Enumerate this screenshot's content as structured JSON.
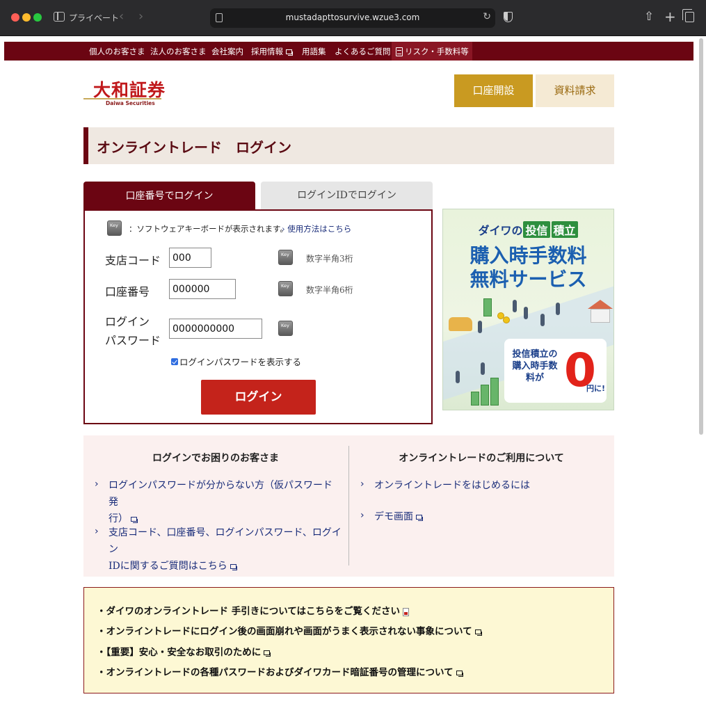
{
  "browser": {
    "private_label": "プライベート",
    "url": "mustadapttosurvive.wzue3.com",
    "back_glyph": "‹",
    "forward_glyph": "›",
    "reload_glyph": "↻",
    "share_glyph": "⇧",
    "newtab_glyph": "+"
  },
  "nav": {
    "items": [
      "個人のお客さま",
      "法人のお客さま",
      "会社案内",
      "採用情報",
      "用語集",
      "よくあるご質問",
      "リスク・手数料等"
    ]
  },
  "logo": {
    "name": "大和証券",
    "sub": "Daiwa Securities"
  },
  "header": {
    "open_account": "口座開設",
    "request_docs": "資料請求"
  },
  "page_title": "オンライントレード　ログイン",
  "tabs": {
    "active": "口座番号でログイン",
    "inactive": "ログインIDでログイン"
  },
  "form": {
    "note": "：ソフトウェアキーボードが表示されます。",
    "note_link": "使用方法はこちら",
    "branch_label": "支店コード",
    "branch_value": "000",
    "branch_hint": "数字半角3桁",
    "account_label": "口座番号",
    "account_value": "000000",
    "account_hint": "数字半角6桁",
    "password_label_1": "ログイン",
    "password_label_2": "パスワード",
    "password_value": "0000000000",
    "show_password": "ログインパスワードを表示する",
    "login_button": "ログイン"
  },
  "banner": {
    "top_prefix": "ダイワの",
    "chip1": "投信",
    "chip2": "積立",
    "line1": "購入時手数料",
    "line2": "無料サービス",
    "bottom_text": "投信積立の購入時手数料が",
    "zero": "0",
    "yen": "円に!"
  },
  "help": {
    "left_title": "ログインでお困りのお客さま",
    "left_link1_a": "ログインパスワードが分からない方（仮パスワード発",
    "left_link1_b": "行）",
    "left_link2_a": "支店コード、口座番号、ログインパスワード、ログイン",
    "left_link2_b": "IDに関するご質問はこちら",
    "right_title": "オンライントレードのご利用について",
    "right_link1": "オンライントレードをはじめるには",
    "right_link2": "デモ画面"
  },
  "notices": [
    "・ダイワのオンライントレード 手引きについてはこちらをご覧ください",
    "・オンライントレードにログイン後の画面崩れや画面がうまく表示されない事象について",
    "・【重要】安心・安全なお取引のために",
    "・オンライントレードの各種パスワードおよびダイワカード暗証番号の管理について"
  ],
  "colors": {
    "brand": "#6b0512",
    "accent_gold": "#c99a21",
    "login_red": "#c4231b"
  }
}
